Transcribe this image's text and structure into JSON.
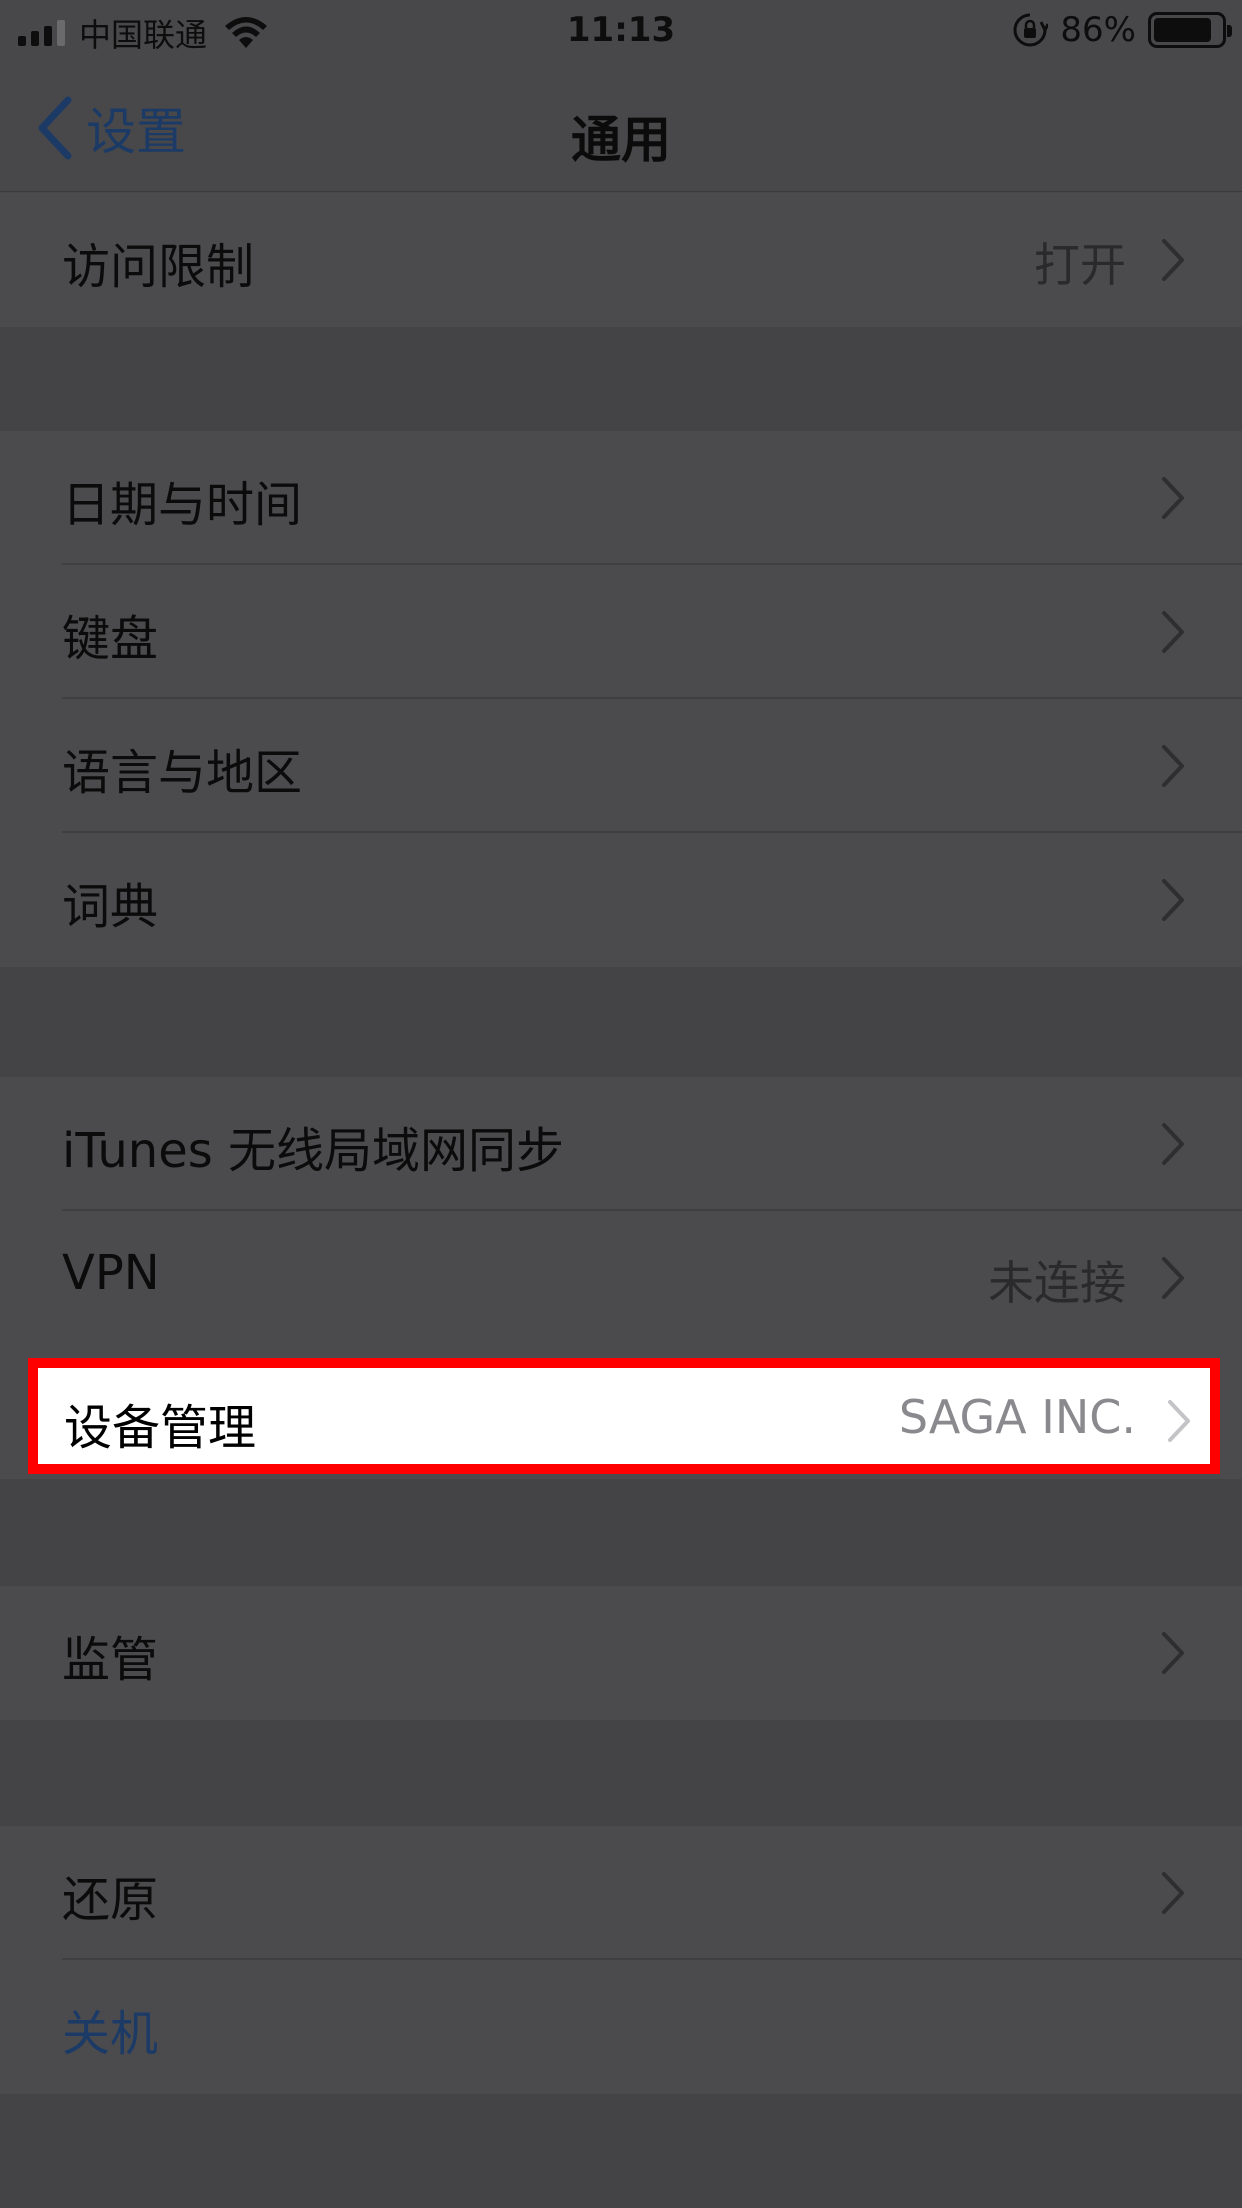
{
  "status_bar": {
    "carrier": "中国联通",
    "time": "11:13",
    "battery": "86%",
    "battery_level": 0.86
  },
  "nav": {
    "back_label": "设置",
    "title": "通用"
  },
  "rows": {
    "restrictions": {
      "label": "访问限制",
      "value": "打开"
    },
    "date_time": {
      "label": "日期与时间"
    },
    "keyboard": {
      "label": "键盘"
    },
    "language_region": {
      "label": "语言与地区"
    },
    "dictionary": {
      "label": "词典"
    },
    "itunes_wifi_sync": {
      "label": "iTunes 无线局域网同步"
    },
    "vpn": {
      "label": "VPN",
      "value": "未连接"
    },
    "device_management": {
      "label": "设备管理",
      "value": "SAGA INC."
    },
    "supervision": {
      "label": "监管"
    },
    "reset": {
      "label": "还原"
    },
    "shutdown": {
      "label": "关机"
    }
  },
  "colors": {
    "highlight_border": "#ff0000",
    "link_blue": "#1c3a66",
    "overlay_background": "#474749"
  },
  "icons": [
    "signal-icon",
    "wifi-icon",
    "rotation-lock-icon",
    "battery-icon",
    "chevron-left-icon",
    "chevron-right-icon"
  ]
}
